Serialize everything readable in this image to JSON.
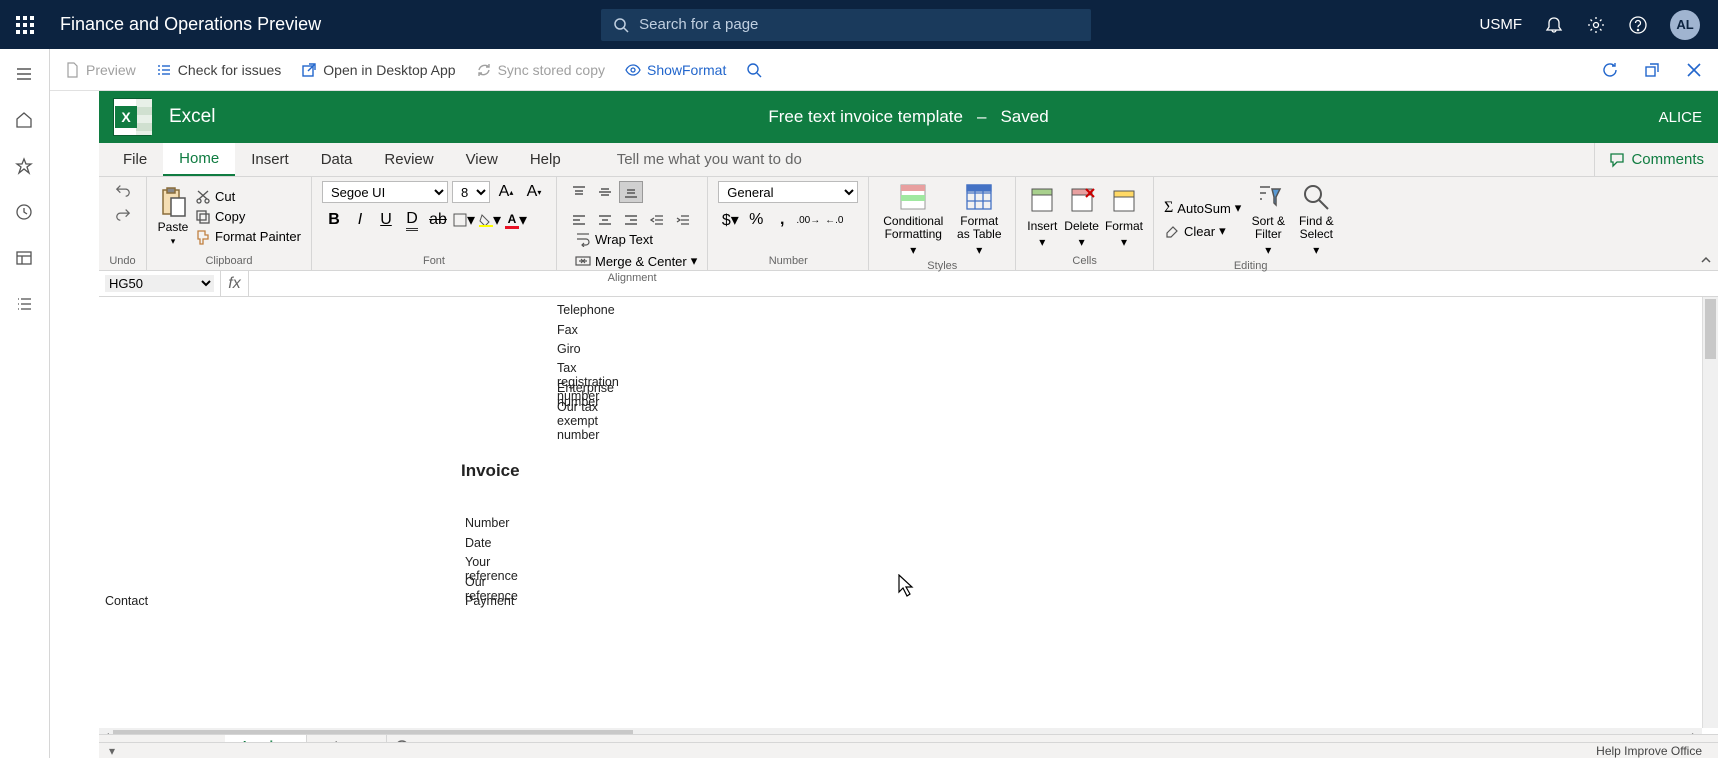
{
  "topbar": {
    "title": "Finance and Operations Preview",
    "search_placeholder": "Search for a page",
    "company": "USMF",
    "avatar": "AL"
  },
  "actionbar": {
    "preview": "Preview",
    "check": "Check for issues",
    "open_desktop": "Open in Desktop App",
    "sync": "Sync stored copy",
    "show_format": "ShowFormat"
  },
  "excel": {
    "app": "Excel",
    "doc": "Free text invoice template",
    "dash": "–",
    "saved": "Saved",
    "user": "ALICE"
  },
  "tabs": [
    "File",
    "Home",
    "Insert",
    "Data",
    "Review",
    "View",
    "Help"
  ],
  "tell_me": "Tell me what you want to do",
  "comments": "Comments",
  "ribbon": {
    "undo": "Undo",
    "paste": "Paste",
    "cut": "Cut",
    "copy": "Copy",
    "format_painter": "Format Painter",
    "clipboard": "Clipboard",
    "font_name": "Segoe UI",
    "font_size": "8",
    "font": "Font",
    "wrap": "Wrap Text",
    "merge": "Merge & Center",
    "alignment": "Alignment",
    "num_format": "General",
    "number": "Number",
    "cond_fmt": "Conditional Formatting",
    "fmt_table": "Format as Table",
    "styles": "Styles",
    "insert": "Insert",
    "delete": "Delete",
    "format": "Format",
    "cells": "Cells",
    "autosum": "AutoSum",
    "clear": "Clear",
    "sort_filter": "Sort & Filter",
    "find_select": "Find & Select",
    "editing": "Editing"
  },
  "name_box": "HG50",
  "sheet": {
    "rows_right": [
      "Telephone",
      "Fax",
      "Giro",
      "Tax registration number",
      "Enterprise number",
      "Our tax exempt number"
    ],
    "invoice": "Invoice",
    "rows_left": [
      "Number",
      "Date",
      "Your reference",
      "Our reference",
      "Payment"
    ],
    "contact": "Contact"
  },
  "sheet_tabs": [
    "Invoice",
    "Giro_FI"
  ],
  "status": {
    "help": "Help Improve Office"
  }
}
